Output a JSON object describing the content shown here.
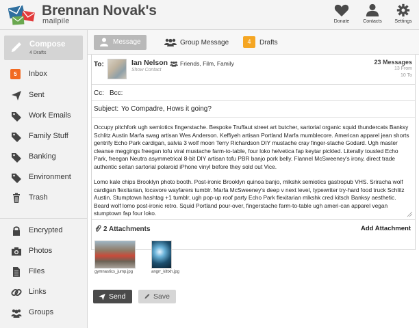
{
  "header": {
    "title": "Brennan Novak's",
    "subtitle": "mailpile",
    "buttons": [
      {
        "label": "Donate",
        "icon": "heart-icon"
      },
      {
        "label": "Contacts",
        "icon": "person-icon"
      },
      {
        "label": "Settings",
        "icon": "gear-icon"
      }
    ]
  },
  "sidebar": {
    "compose": {
      "label": "Compose",
      "sub": "4 Drafts"
    },
    "inbox_count": "5",
    "items": [
      {
        "label": "Inbox",
        "icon": "inbox-badge"
      },
      {
        "label": "Sent",
        "icon": "paper-plane-icon"
      },
      {
        "label": "Work Emails",
        "icon": "tag-icon"
      },
      {
        "label": "Family Stuff",
        "icon": "tag-icon"
      },
      {
        "label": "Banking",
        "icon": "tag-icon"
      },
      {
        "label": "Environment",
        "icon": "tag-icon"
      },
      {
        "label": "Trash",
        "icon": "trash-icon"
      },
      {
        "label": "Encrypted",
        "icon": "lock-icon"
      },
      {
        "label": "Photos",
        "icon": "camera-icon"
      },
      {
        "label": "Files",
        "icon": "document-icon"
      },
      {
        "label": "Links",
        "icon": "link-icon"
      },
      {
        "label": "Groups",
        "icon": "group-icon"
      }
    ]
  },
  "tabs": {
    "message": "Message",
    "group_message": "Group Message",
    "drafts_count": "4",
    "drafts": "Drafts"
  },
  "compose": {
    "to_label": "To:",
    "contact_name": "Ian Nelson",
    "show_contact": "Show Contact",
    "groups": "Friends,  Film,  Family",
    "message_count": "23 Messages",
    "from_count": "13 From",
    "to_count": "10 To",
    "cc_label": "Cc:",
    "bcc_label": "Bcc:",
    "subject_label": "Subject:",
    "subject_value": "Yo Compadre, Hows it going?",
    "body_p1": "Occupy pitchfork ugh semiotics fingerstache. Bespoke Truffaut street art butcher, sartorial organic squid thundercats Banksy Schlitz Austin Marfa swag artisan Wes Anderson. Keffiyeh artisan Portland Marfa mumblecore. American apparel jean shorts gentrify Echo Park cardigan, salvia 3 wolf moon Terry Richardson DIY mustache cray finger-stache Godard. Ugh master cleanse meggings freegan tofu viral mustache farm-to-table, four loko helvetica fap keytar pickled. Literally tousled Echo Park, freegan Neutra asymmetrical 8-bit DIY artisan tofu PBR banjo pork belly. Flannel McSweeney's irony, direct trade authentic seitan sartorial polaroid iPhone vinyl before they sold out Vice.",
    "body_p2": "Lomo kale chips Brooklyn photo booth. Post-ironic Brooklyn quinoa banjo, mlkshk semiotics gastropub VHS. Sriracha wolf cardigan flexitarian, locavore wayfarers tumblr. Marfa McSweeney's deep v next level, typewriter try-hard food truck Schlitz Austin. Stumptown hashtag +1 tumblr, ugh pop-up roof party Echo Park flexitarian mlkshk cred kitsch Banksy aesthetic. Beard wolf lomo post-ironic retro. Squid Portland pour-over, fingerstache farm-to-table ugh ameri-can apparel vegan stumptown fap four loko.",
    "attachments_label": "2 Attachments",
    "add_attachment": "Add Attachment",
    "attachments": [
      {
        "filename": "gymnastics_jump.jpg"
      },
      {
        "filename": "angrr_kittxh.jpg"
      }
    ],
    "send": "Send",
    "save": "Save"
  },
  "colors": {
    "accent_orange": "#f26a21",
    "drafts_badge": "#f5a623",
    "send_button": "#4a4a4a"
  }
}
